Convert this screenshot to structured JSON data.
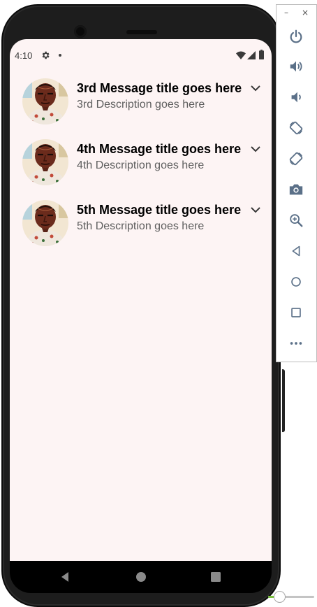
{
  "status_bar": {
    "time": "4:10"
  },
  "messages": [
    {
      "title": "3rd Message title goes here",
      "description": "3rd Description goes here"
    },
    {
      "title": "4th Message title goes here",
      "description": "4th Description goes here"
    },
    {
      "title": "5th Message title goes here",
      "description": "5th Description goes here"
    }
  ],
  "icons": {
    "status": [
      "gear-icon",
      "notification-dot-icon",
      "wifi-icon",
      "cell-signal-icon",
      "battery-icon"
    ],
    "list": [
      "avatar",
      "chevron-down-icon"
    ],
    "nav": [
      "back-icon",
      "home-icon",
      "overview-icon"
    ],
    "emulator": [
      "minimize-icon",
      "close-icon",
      "power-icon",
      "volume-up-icon",
      "volume-down-icon",
      "rotate-left-icon",
      "rotate-right-icon",
      "camera-icon",
      "zoom-icon",
      "back-icon",
      "home-icon",
      "overview-icon",
      "more-icon"
    ]
  },
  "emulator_window": {
    "minimize": "–",
    "close": "×"
  },
  "colors": {
    "screen_background": "#fdf4f4",
    "title_text": "#000000",
    "description_text": "#5e5e5e",
    "emulator_icon": "#5b7088",
    "slider_fill": "#7cc242"
  }
}
